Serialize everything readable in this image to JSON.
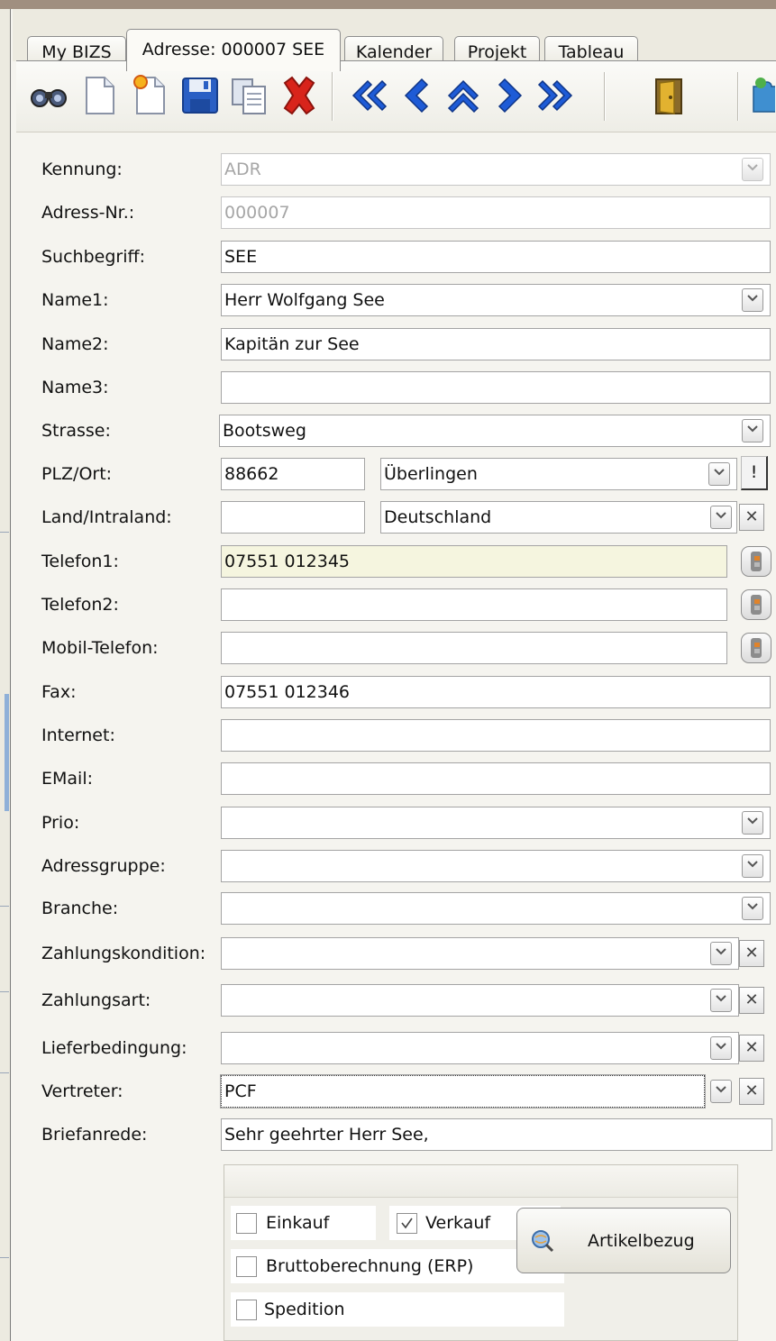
{
  "tabs": [
    {
      "label": "My BIZS"
    },
    {
      "label": "Adresse: 000007 SEE",
      "active": true
    },
    {
      "label": "Kalender"
    },
    {
      "label": "Projekt"
    },
    {
      "label": "Tableau"
    }
  ],
  "toolbar": {
    "icons": [
      "binoculars-icon",
      "new-document-icon",
      "new-document-star-icon",
      "save-disk-icon",
      "copy-document-icon",
      "delete-x-icon",
      "first-record-icon",
      "previous-record-icon",
      "up-record-icon",
      "next-record-icon",
      "last-record-icon",
      "exit-door-icon",
      "puzzle-icon"
    ],
    "colors": {
      "nav": "#1e5bd6",
      "delete": "#d8241b",
      "save": "#2a5fc4",
      "door": "#d6a11e"
    }
  },
  "form": {
    "kennung": {
      "label": "Kennung:",
      "value": "ADR"
    },
    "adress_nr": {
      "label": "Adress-Nr.:",
      "value": "000007"
    },
    "suchbegriff": {
      "label": "Suchbegriff:",
      "value": "SEE"
    },
    "name1": {
      "label": "Name1:",
      "value": "Herr Wolfgang See"
    },
    "name2": {
      "label": "Name2:",
      "value": "Kapitän zur See"
    },
    "name3": {
      "label": "Name3:",
      "value": ""
    },
    "strasse": {
      "label": "Strasse:",
      "value": "Bootsweg"
    },
    "plz_ort": {
      "label": "PLZ/Ort:",
      "plz": "88662",
      "ort": "Überlingen",
      "button": "!"
    },
    "land": {
      "label": "Land/Intraland:",
      "intraland": "",
      "land": "Deutschland"
    },
    "telefon1": {
      "label": "Telefon1:",
      "value": "07551 012345"
    },
    "telefon2": {
      "label": "Telefon2:",
      "value": ""
    },
    "mobil": {
      "label": "Mobil-Telefon:",
      "value": ""
    },
    "fax": {
      "label": "Fax:",
      "value": "07551 012346"
    },
    "internet": {
      "label": "Internet:",
      "value": ""
    },
    "email": {
      "label": "EMail:",
      "value": ""
    },
    "prio": {
      "label": "Prio:",
      "value": ""
    },
    "adressgruppe": {
      "label": "Adressgruppe:",
      "value": ""
    },
    "branche": {
      "label": "Branche:",
      "value": ""
    },
    "zahlungskondition": {
      "label": "Zahlungskondition:",
      "value": ""
    },
    "zahlungsart": {
      "label": "Zahlungsart:",
      "value": ""
    },
    "lieferbedingung": {
      "label": "Lieferbedingung:",
      "value": ""
    },
    "vertreter": {
      "label": "Vertreter:",
      "value": "PCF"
    },
    "briefanrede": {
      "label": "Briefanrede:",
      "value": "Sehr geehrter Herr See,"
    }
  },
  "options": {
    "einkauf": {
      "label": "Einkauf",
      "checked": false
    },
    "verkauf": {
      "label": "Verkauf",
      "checked": true
    },
    "brutto": {
      "label": "Bruttoberechnung (ERP)",
      "checked": false
    },
    "spedition": {
      "label": "Spedition",
      "checked": false
    }
  },
  "artikelbezug_button": "Artikelbezug"
}
